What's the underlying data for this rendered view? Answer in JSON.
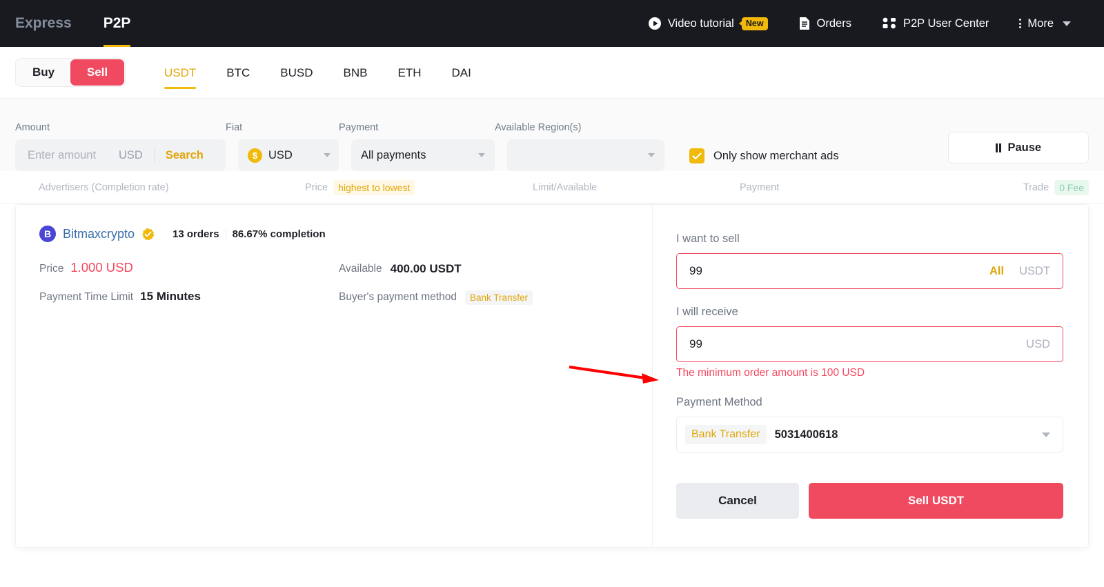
{
  "topnav": {
    "tabs": [
      {
        "label": "Express",
        "active": false
      },
      {
        "label": "P2P",
        "active": true
      }
    ],
    "items": [
      {
        "label": "Video tutorial",
        "icon": "play-circle-icon",
        "badge": "New"
      },
      {
        "label": "Orders",
        "icon": "document-icon"
      },
      {
        "label": "P2P User Center",
        "icon": "users-icon"
      },
      {
        "label": "More",
        "icon": "kebab-icon"
      }
    ]
  },
  "subnav": {
    "buy_label": "Buy",
    "sell_label": "Sell",
    "active_side": "Sell",
    "coins": [
      "USDT",
      "BTC",
      "BUSD",
      "BNB",
      "ETH",
      "DAI"
    ],
    "active_coin": "USDT"
  },
  "filters": {
    "amount_label": "Amount",
    "amount_placeholder": "Enter amount",
    "amount_value": "",
    "amount_currency": "USD",
    "search_label": "Search",
    "fiat_label": "Fiat",
    "fiat_value": "USD",
    "fiat_symbol": "$",
    "payment_label": "Payment",
    "payment_value": "All payments",
    "region_label": "Available Region(s)",
    "region_value": "",
    "merchant_label": "Only show merchant ads",
    "merchant_checked": true,
    "pause_label": "Pause"
  },
  "columns": {
    "advertisers": "Advertisers (Completion rate)",
    "price": "Price",
    "price_sort": "highest to lowest",
    "limit": "Limit/Available",
    "payment": "Payment",
    "trade": "Trade",
    "fee": "0 Fee"
  },
  "offer": {
    "avatar_initial": "B",
    "name": "Bitmaxcrypto",
    "verified": true,
    "orders": "13 orders",
    "completion": "86.67% completion",
    "price_label": "Price",
    "price_value": "1.000 USD",
    "available_label": "Available",
    "available_value": "400.00 USDT",
    "time_limit_label": "Payment Time Limit",
    "time_limit_value": "15 Minutes",
    "buyer_pm_label": "Buyer's payment method",
    "buyer_pm_value": "Bank Transfer"
  },
  "form": {
    "sell_label": "I want to sell",
    "sell_value": "99",
    "sell_all": "All",
    "sell_unit": "USDT",
    "receive_label": "I will receive",
    "receive_value": "99",
    "receive_unit": "USD",
    "error": "The minimum order amount is 100 USD",
    "pm_label": "Payment Method",
    "pm_tag": "Bank Transfer",
    "pm_number": "5031400618",
    "cancel_label": "Cancel",
    "submit_label": "Sell USDT"
  },
  "colors": {
    "brand_yellow": "#f0b90b",
    "sell_red": "#ef4a5f",
    "error_red": "#f6465d",
    "nav_dark": "#181a20",
    "annotation_red": "#ff0000"
  }
}
